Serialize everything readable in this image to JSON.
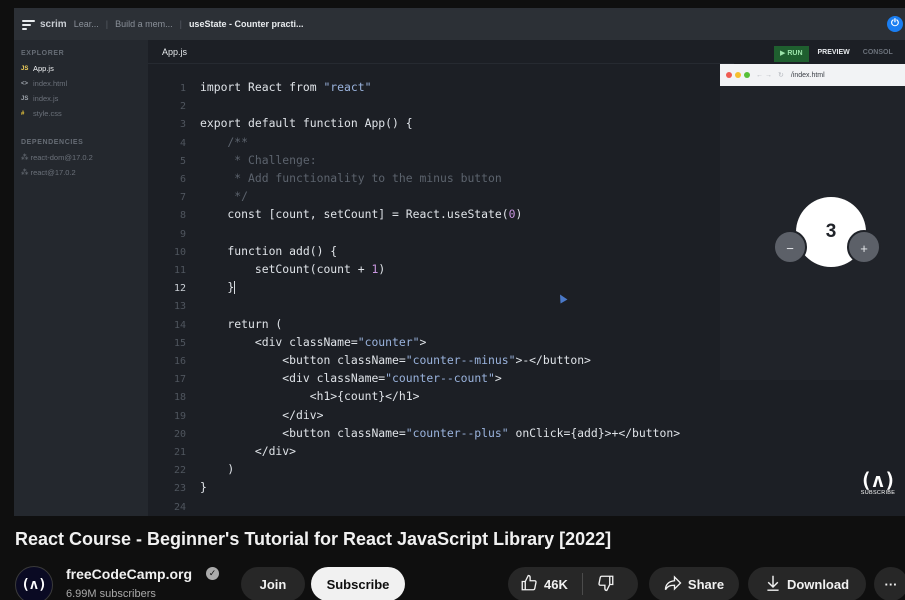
{
  "topbar": {
    "app": "scrim",
    "crumbs": [
      "Lear...",
      "Build a mem...",
      "useState - Counter practi..."
    ]
  },
  "sidebar": {
    "explorer_label": "EXPLORER",
    "files": [
      {
        "icon": "JS",
        "name": "App.js"
      },
      {
        "icon": "<>",
        "name": "index.html"
      },
      {
        "icon": "JS",
        "name": "index.js"
      },
      {
        "icon": "#",
        "name": "style.css"
      }
    ],
    "dependencies_label": "DEPENDENCIES",
    "dependencies": [
      "react-dom@17.0.2",
      "react@17.0.2"
    ]
  },
  "editor": {
    "tab": "App.js",
    "lines": [
      {
        "n": "1",
        "text": "import React from \"react\""
      },
      {
        "n": "2",
        "text": ""
      },
      {
        "n": "3",
        "text": "export default function App() {"
      },
      {
        "n": "4",
        "text": "    /**"
      },
      {
        "n": "5",
        "text": "     * Challenge:"
      },
      {
        "n": "6",
        "text": "     * Add functionality to the minus button"
      },
      {
        "n": "7",
        "text": "     */"
      },
      {
        "n": "8",
        "text": "    const [count, setCount] = React.useState(0)"
      },
      {
        "n": "9",
        "text": ""
      },
      {
        "n": "10",
        "text": "    function add() {"
      },
      {
        "n": "11",
        "text": "        setCount(count + 1)"
      },
      {
        "n": "12",
        "text": "    }"
      },
      {
        "n": "13",
        "text": ""
      },
      {
        "n": "14",
        "text": "    return ("
      },
      {
        "n": "15",
        "text": "        <div className=\"counter\">"
      },
      {
        "n": "16",
        "text": "            <button className=\"counter--minus\">-</button>"
      },
      {
        "n": "17",
        "text": "            <div className=\"counter--count\">"
      },
      {
        "n": "18",
        "text": "                <h1>{count}</h1>"
      },
      {
        "n": "19",
        "text": "            </div>"
      },
      {
        "n": "20",
        "text": "            <button className=\"counter--plus\" onClick={add}>+</button>"
      },
      {
        "n": "21",
        "text": "        </div>"
      },
      {
        "n": "22",
        "text": "    )"
      },
      {
        "n": "23",
        "text": "}"
      },
      {
        "n": "24",
        "text": ""
      }
    ],
    "current_line": "12"
  },
  "preview": {
    "run_label": "▶ RUN",
    "preview_label": "PREVIEW",
    "console_label": "CONSOL",
    "url": "/index.html",
    "count": "3",
    "minus": "−",
    "plus": "+"
  },
  "watermark": {
    "glyph": "(ʌ)",
    "text": "SUBSCRIBE"
  },
  "video": {
    "title": "React Course - Beginner's Tutorial for React JavaScript Library [2022]",
    "channel": "freeCodeCamp.org",
    "subscribers": "6.99M subscribers",
    "avatar_glyph": "(ʌ)",
    "join_label": "Join",
    "subscribe_label": "Subscribe",
    "likes": "46K",
    "share_label": "Share",
    "download_label": "Download",
    "more_label": "···"
  },
  "colors": {
    "string": "#9ab3dd",
    "comment": "#5c636d",
    "number": "#c996e0",
    "accent": "#1a7ef2"
  }
}
